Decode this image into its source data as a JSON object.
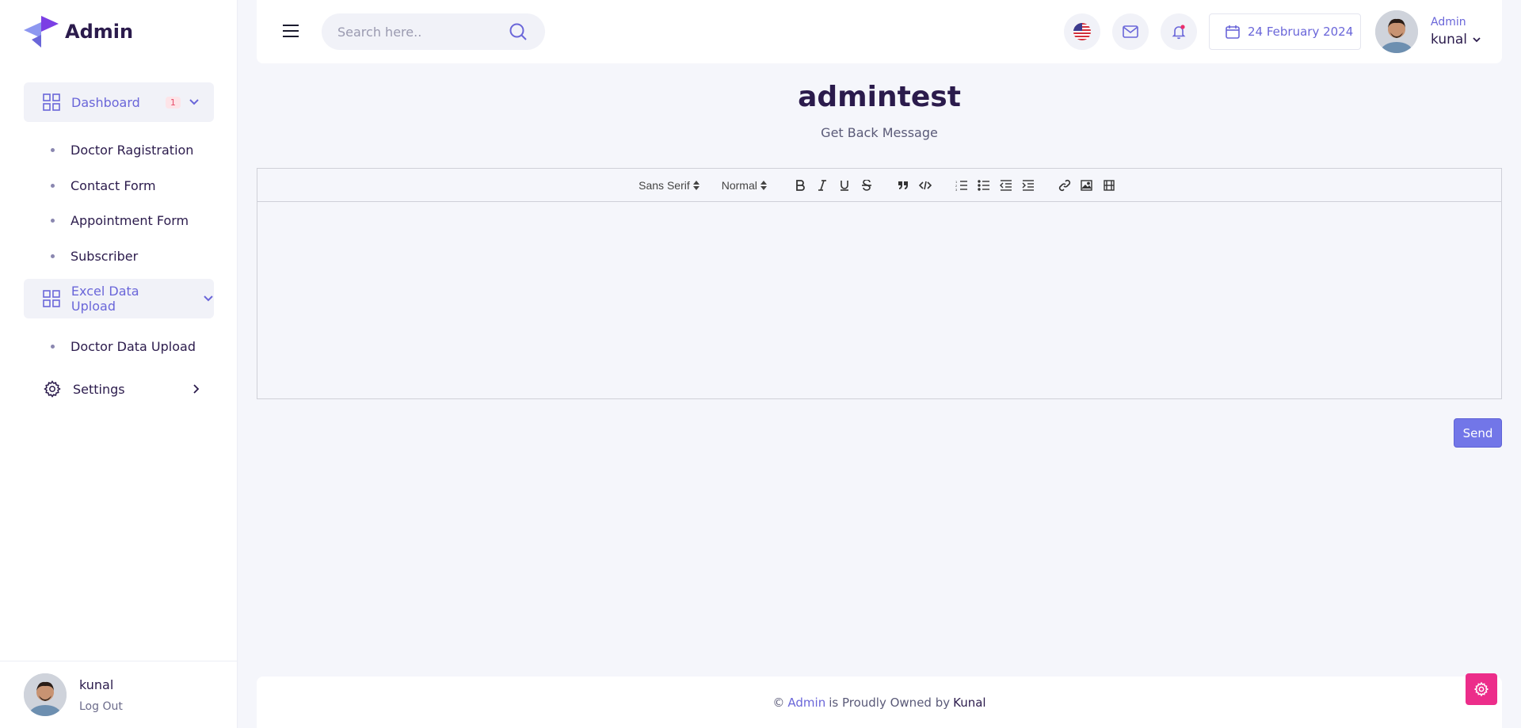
{
  "app": {
    "name": "Admin"
  },
  "sidebar": {
    "groups": [
      {
        "label": "Dashboard",
        "badge": "1"
      },
      {
        "label": "Excel Data Upload"
      }
    ],
    "dashboard_items": [
      "Doctor Ragistration",
      "Contact Form",
      "Appointment Form",
      "Subscriber"
    ],
    "excel_items": [
      "Doctor Data Upload"
    ],
    "settings_label": "Settings",
    "user": {
      "name": "kunal",
      "logout": "Log Out"
    }
  },
  "topbar": {
    "search_placeholder": "Search here..",
    "date": "24 February 2024",
    "user": {
      "role": "Admin",
      "name": "kunal"
    }
  },
  "page": {
    "title": "admintest",
    "subtitle": "Get Back Message"
  },
  "editor": {
    "font": "Sans Serif",
    "size": "Normal"
  },
  "actions": {
    "send": "Send"
  },
  "footer": {
    "copyright": "©",
    "brand": "Admin",
    "middle": "is Proudly Owned by",
    "owner": "Kunal"
  },
  "colors": {
    "accent": "#6a66d9",
    "send": "#7276e8",
    "fab": "#ec2d8a",
    "text": "#2b1b4c"
  }
}
